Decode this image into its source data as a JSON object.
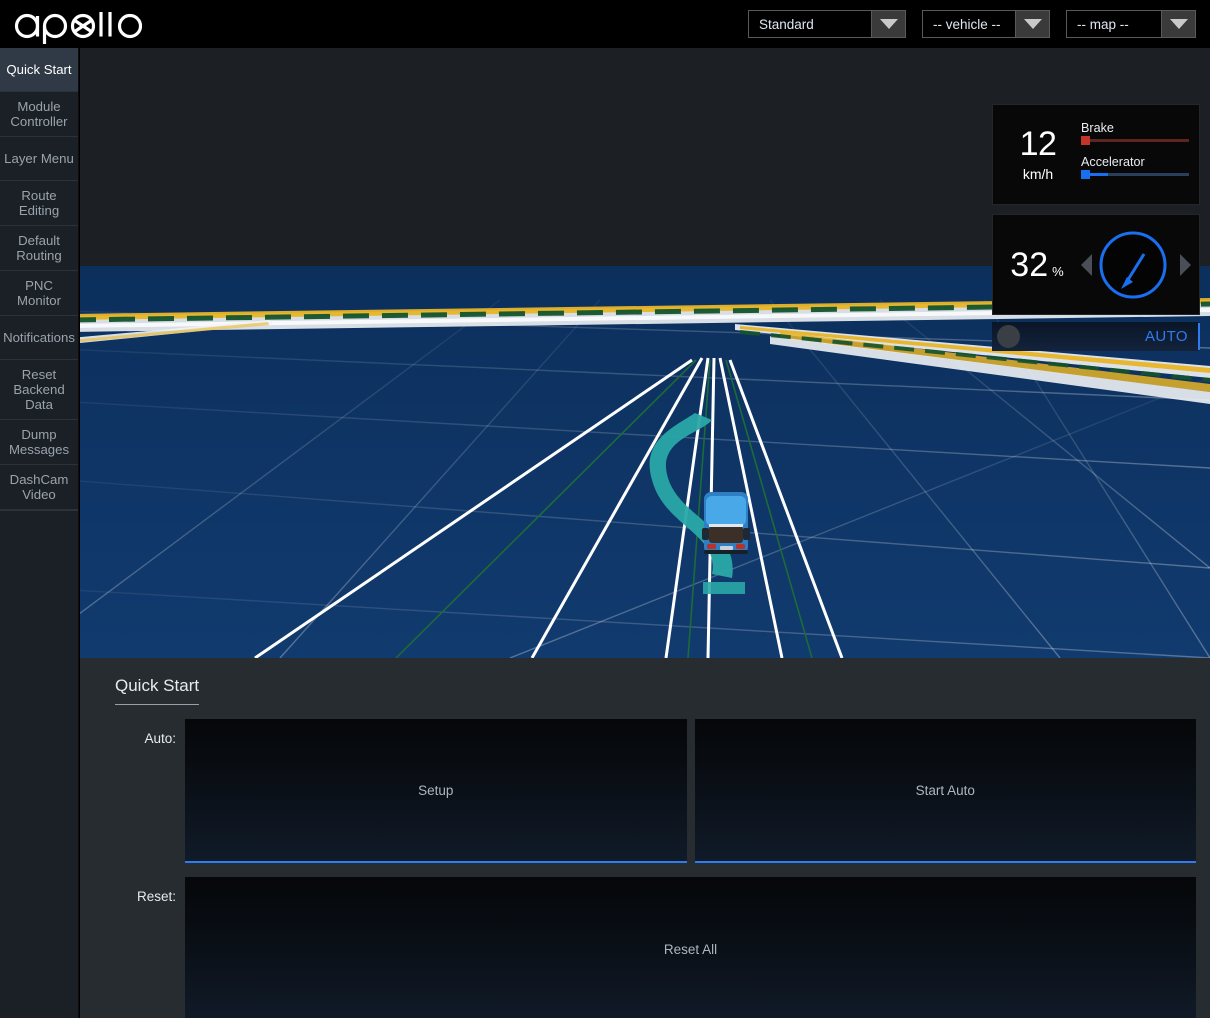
{
  "header": {
    "logo_text": "apollo",
    "selects": [
      {
        "name": "mode-select",
        "value": "Standard",
        "icon": "chevron-down-icon"
      },
      {
        "name": "vehicle-select",
        "value": "-- vehicle --",
        "icon": "chevron-down-icon"
      },
      {
        "name": "map-select",
        "value": "-- map --",
        "icon": "chevron-down-icon"
      }
    ]
  },
  "sidebar": {
    "items": [
      {
        "label": "Quick Start",
        "active": true
      },
      {
        "label": "Module Controller",
        "active": false
      },
      {
        "label": "Layer Menu",
        "active": false
      },
      {
        "label": "Route Editing",
        "active": false
      },
      {
        "label": "Default Routing",
        "active": false
      },
      {
        "label": "PNC Monitor",
        "active": false
      },
      {
        "label": "Notifications",
        "active": false
      },
      {
        "label": "Reset Backend Data",
        "active": false
      },
      {
        "label": "Dump Messages",
        "active": false
      },
      {
        "label": "DashCam Video",
        "active": false
      }
    ]
  },
  "hud": {
    "speed": {
      "value": "12",
      "unit": "km/h",
      "brake_label": "Brake",
      "brake_percent": 0,
      "accelerator_label": "Accelerator",
      "accelerator_percent": 25
    },
    "steering": {
      "value": "32",
      "unit": "%",
      "left_arrow": "triangle-left-icon",
      "right_arrow": "triangle-right-icon",
      "wheel_icon": "steering-wheel-icon",
      "needle_angle_deg": 32
    },
    "auto": {
      "label": "AUTO",
      "enabled": false
    }
  },
  "scene": {
    "ego_vehicle": "blue-sedan",
    "planning_trajectory_color": "#2aa8a8",
    "ground_color": "#0e3464",
    "lane_line_color": "#ffffff",
    "lane_center_color": "#14532d",
    "crosswalk_color": "#e8b830"
  },
  "panel": {
    "title": "Quick Start",
    "rows": [
      {
        "label": "Auto:",
        "buttons": [
          {
            "label": "Setup",
            "name": "setup-button"
          },
          {
            "label": "Start Auto",
            "name": "start-auto-button"
          }
        ]
      },
      {
        "label": "Reset:",
        "buttons": [
          {
            "label": "Reset All",
            "name": "reset-all-button"
          }
        ]
      }
    ]
  },
  "colors": {
    "accent_blue": "#2f7bf2",
    "panel_bg": "#272c30",
    "sidebar_bg": "#1b2027",
    "sidebar_active_bg": "#2f3a46",
    "brake_red": "#c3352c",
    "accel_blue": "#1a6ff0"
  }
}
